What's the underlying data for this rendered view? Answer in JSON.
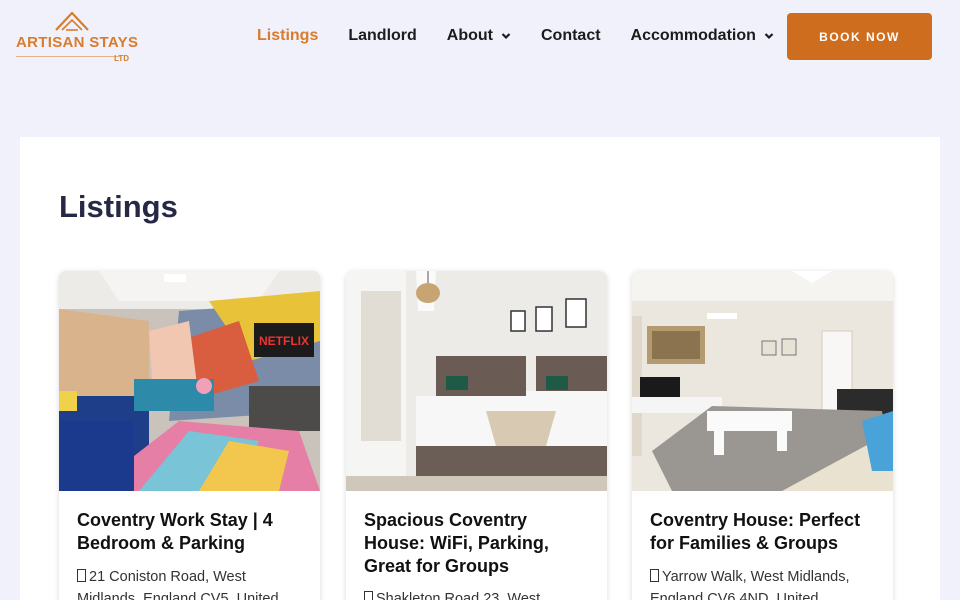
{
  "brand": {
    "name": "ARTISAN STAYS",
    "suffix": "LTD",
    "color": "#d97c2b"
  },
  "nav": {
    "items": [
      {
        "label": "Listings",
        "active": true,
        "dropdown": false
      },
      {
        "label": "Landlord",
        "active": false,
        "dropdown": false
      },
      {
        "label": "About",
        "active": false,
        "dropdown": true
      },
      {
        "label": "Contact",
        "active": false,
        "dropdown": false
      },
      {
        "label": "Accommodation",
        "active": false,
        "dropdown": true
      }
    ],
    "cta_label": "BOOK NOW",
    "cta_color": "#cf6d1f"
  },
  "page": {
    "title": "Listings"
  },
  "listings": [
    {
      "title": "Coventry Work Stay | 4 Bedroom & Parking",
      "address": "21 Coniston Road, West Midlands, England CV5, United"
    },
    {
      "title": "Spacious Coventry House: WiFi, Parking, Great for Groups",
      "address": "Shakleton Road 23, West"
    },
    {
      "title": "Coventry House: Perfect for Families & Groups",
      "address": "Yarrow Walk, West Midlands, England CV6 4ND, United"
    }
  ]
}
